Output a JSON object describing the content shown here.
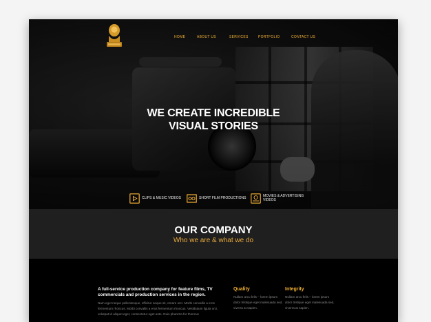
{
  "nav": {
    "items": [
      "HOME",
      "ABOUT US",
      "SERVICES",
      "PORTFOLIO",
      "CONTACT US"
    ]
  },
  "hero": {
    "headline_line1": "WE CREATE INCREDIBLE",
    "headline_line2": "VISUAL STORIES"
  },
  "features": [
    {
      "label": "CLIPS & MUSIC VIDEOS",
      "icon": "play-video-icon"
    },
    {
      "label": "SHORT FILM PRODUCTIONS",
      "icon": "film-icon"
    },
    {
      "label": "MOVIES & ADVERTISING VIDEOS",
      "icon": "cinema-icon"
    }
  ],
  "company": {
    "title": "OUR COMPANY",
    "subtitle": "Who we are & what we do"
  },
  "intro": {
    "title": "A full-service production company for feature films, TV commercials and production services in the region.",
    "text": "Nam eget neque pellentesque, efficitur neque sit, ornare orci. Morbi convallis a eros fermentum rhoncus. Morbi convallis a eros fermentum rhoncus. Vestibulum ligula orci, volutpat id aliquet eget, consectetur eget ante. Duis pharetra for thoncus"
  },
  "columns": [
    {
      "title": "Quality",
      "text": "Nullam arcu felis – lorem ipsum dolor tristique eget malesuada sed, viverra at sapien."
    },
    {
      "title": "Integrity",
      "text": "Nullam arcu felis – lorem ipsum dolor tristique eget malesuada sed, viverra at sapien."
    }
  ],
  "colors": {
    "accent": "#f2b035",
    "subtitle_accent": "#e8a93d",
    "band": "#1f1f1f",
    "background": "#000000"
  }
}
